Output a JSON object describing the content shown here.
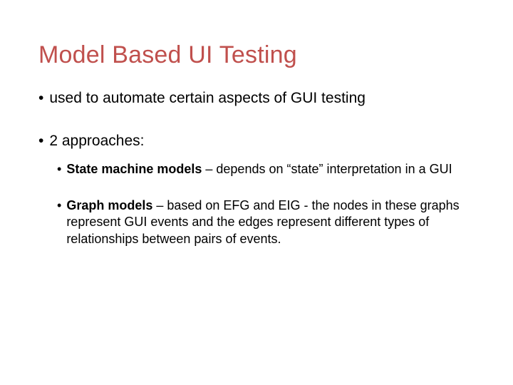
{
  "title": "Model Based UI Testing",
  "bullets": [
    {
      "text": "used to automate certain aspects of GUI testing"
    },
    {
      "text": "2 approaches:",
      "children": [
        {
          "lead": "State machine models",
          "rest": " – depends on “state” interpretation in a GUI"
        },
        {
          "lead": "Graph models",
          "rest": " – based on EFG and EIG - the nodes in these graphs represent GUI events and the edges represent different types of relationships between pairs of events."
        }
      ]
    }
  ]
}
